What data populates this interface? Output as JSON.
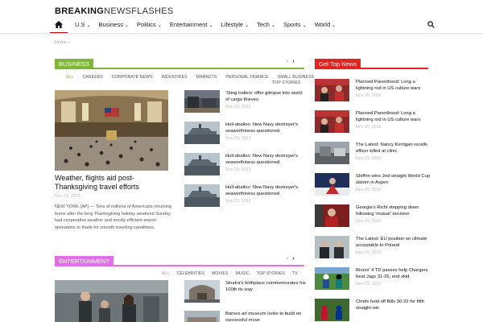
{
  "brand": {
    "bold": "BREAKING",
    "light": "NEWSFLASHES"
  },
  "nav": {
    "items": [
      {
        "label": "U.S"
      },
      {
        "label": "Business"
      },
      {
        "label": "Politics"
      },
      {
        "label": "Entertainment"
      },
      {
        "label": "Lifestyle"
      },
      {
        "label": "Tech"
      },
      {
        "label": "Sports"
      },
      {
        "label": "World"
      }
    ],
    "home_icon": "home-icon",
    "search_icon": "search-icon"
  },
  "breadcrumb": {
    "home": "Home",
    "sep": "»"
  },
  "business": {
    "label": "BUSINESS",
    "color": "#7fb63b",
    "tabs": [
      "ALL",
      "CAREERS",
      "CORPORATE NEWS",
      "INDUSTRIES",
      "MARKETS",
      "PERSONAL FINANCE",
      "SMALL BUSINESS"
    ],
    "tab_more": "TOP STORIES",
    "main": {
      "title": "Weather, flights aid post-Thanksgiving travel efforts",
      "date": "Nov 29, 2013",
      "body": "NEW YORK (AP) — Tens of millions of Americans returning home after the long Thanksgiving holiday weekend Sunday had cooperative weather and mostly efficient airport operations to thank for smooth traveling conditions."
    },
    "list": [
      {
        "title": "'Sting trailers' offer glimpse into world of cargo thieves",
        "date": "Nov 29, 2013"
      },
      {
        "title": "Hull-aballoo: New Navy destroyer's seaworthiness questioned",
        "date": "Nov 29, 2013"
      },
      {
        "title": "Hull-aballoo: New Navy destroyer's seaworthiness questioned",
        "date": "Nov 29, 2013"
      },
      {
        "title": "Hull-aballoo: New Navy destroyer's seaworthiness questioned",
        "date": "Nov 29, 2013"
      }
    ]
  },
  "entertainment": {
    "label": "ENTERTAINMENT",
    "color": "#e36ee8",
    "tabs": [
      "ALL",
      "CELEBRITIES",
      "MOVIES",
      "MUSIC",
      "TOP STORIES",
      "TV"
    ],
    "list": [
      {
        "title": "Sinatra's birthplace commemorates his 100th its way"
      },
      {
        "title": "Barnes art museum looks to build on successful move"
      }
    ]
  },
  "top_news": {
    "label": "Get Top News",
    "color": "#e32222",
    "items": [
      {
        "title": "Planned Parenthood: Long a lightning rod in US culture wars",
        "date": "Nov 29, 2013"
      },
      {
        "title": "Planned Parenthood: Long a lightning rod in US culture wars",
        "date": "Nov 29, 2013"
      },
      {
        "title": "The Latest: Nancy Kerrigan recalls officer killed at clinic",
        "date": "Nov 29, 2013"
      },
      {
        "title": "Shiffrin wins 2nd straight World Cup slalom in Aspen",
        "date": "Nov 29, 2013"
      },
      {
        "title": "Georgia's Richt stepping down following 'mutual' decision",
        "date": "Nov 29, 2013"
      },
      {
        "title": "The Latest: EU position on climate acceptable to Poland",
        "date": "Nov 29, 2013"
      },
      {
        "title": "Rivers' 4 TD passes help Chargers beat Jags 31-25, end skid",
        "date": "Nov 29, 2013"
      },
      {
        "title": "Chiefs hold off Bills 30-22 for fifth straight win",
        "date": ""
      }
    ]
  },
  "arrows": {
    "prev": "‹",
    "next": "›"
  }
}
